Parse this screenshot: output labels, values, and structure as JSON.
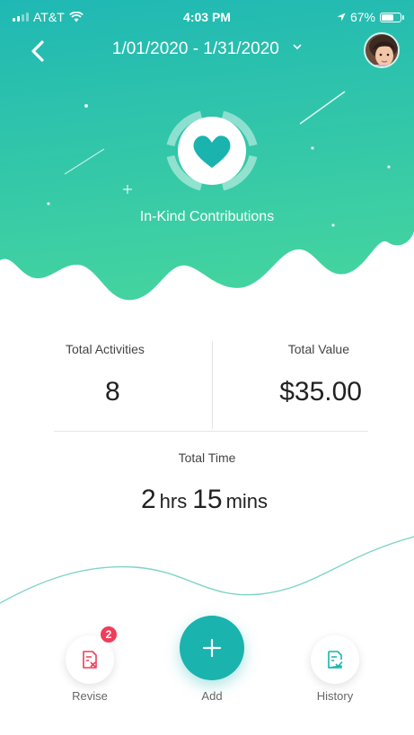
{
  "status_bar": {
    "carrier": "AT&T",
    "time": "4:03 PM",
    "battery_text": "67%",
    "battery_level": 0.67
  },
  "header": {
    "date_range": "1/01/2020 - 1/31/2020",
    "title": "In-Kind Contributions"
  },
  "stats": {
    "activities_label": "Total Activities",
    "activities_value": "8",
    "value_label": "Total Value",
    "value_value": "$35.00",
    "time_label": "Total Time",
    "time_hours": "2",
    "time_hours_unit": "hrs",
    "time_minutes": "15",
    "time_minutes_unit": "mins"
  },
  "actions": {
    "revise_label": "Revise",
    "revise_badge": "2",
    "add_label": "Add",
    "history_label": "History"
  },
  "colors": {
    "accent": "#1ab3ae",
    "gradient_top": "#22c2b1",
    "gradient_bottom": "#3ccf9b",
    "badge": "#ef3d5b"
  }
}
